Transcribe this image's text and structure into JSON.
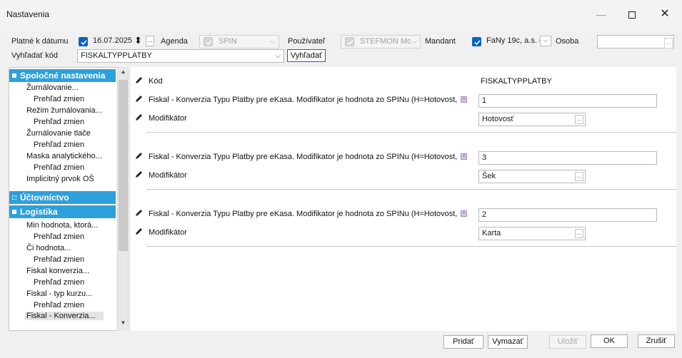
{
  "window": {
    "title": "Nastavenia",
    "minimize_glyph": "—",
    "close_glyph": "✕"
  },
  "filters": {
    "valid_date_label": "Platné k dátumu",
    "valid_date_value": "16.07.2025",
    "agenda_label": "Agenda",
    "agenda_value": "SPIN",
    "user_label": "Používateľ",
    "user_value": "STEFMON Mc",
    "mandant_label": "Mandant",
    "mandant_value": "FaNy 19c, a.s. (",
    "person_label": "Osoba",
    "person_value": "",
    "search_code_label": "Vyhľadať kód",
    "search_code_value": "FISKALTYPPLATBY",
    "search_button": "Vyhľadať",
    "ellipsis": "...",
    "dropdown_glyph": "⌵",
    "spin_glyph": "⬍"
  },
  "tree": {
    "sections": [
      {
        "label": "Spoločné nastavenia"
      },
      {
        "label": "Účtovníctvo"
      },
      {
        "label": "Logistika"
      }
    ],
    "common_items": [
      {
        "label": "Žurnálovanie...",
        "level": 1
      },
      {
        "label": "Prehľad zmien",
        "level": 2
      },
      {
        "label": "Režim žurnálovania...",
        "level": 1
      },
      {
        "label": "Prehľad zmien",
        "level": 2
      },
      {
        "label": "Žurnálovanie tlače",
        "level": 1
      },
      {
        "label": "Prehľad zmien",
        "level": 2
      },
      {
        "label": "Maska analytického...",
        "level": 1
      },
      {
        "label": "Prehľad zmien",
        "level": 2
      },
      {
        "label": "Implicitný prvok OŠ",
        "level": 1
      }
    ],
    "logistics_items": [
      {
        "label": "Min hodnota, ktorá...",
        "level": 1
      },
      {
        "label": "Prehľad zmien",
        "level": 2
      },
      {
        "label": "Či hodnota...",
        "level": 1
      },
      {
        "label": "Prehľad zmien",
        "level": 2
      },
      {
        "label": "Fiskal konverzia...",
        "level": 1
      },
      {
        "label": "Prehľad zmien",
        "level": 2
      },
      {
        "label": "Fiskal - typ kurzu...",
        "level": 1
      },
      {
        "label": "Prehľad zmien",
        "level": 2
      },
      {
        "label": "Fiskal - Konverzia...",
        "level": 1,
        "selected": true
      }
    ],
    "scroll_up": "▲",
    "scroll_down": "▼"
  },
  "detail": {
    "code_label": "Kód",
    "code_value": "FISKALTYPPLATBY",
    "groups": [
      {
        "param_label": "Fiskal - Konverzia Typu Platby pre eKasa. Modifikator je hodnota zo SPINu (H=Hotovost,",
        "param_value": "1",
        "modifier_label": "Modifikátor",
        "modifier_value": "Hotovosť"
      },
      {
        "param_label": "Fiskal - Konverzia Typu Platby pre eKasa. Modifikator je hodnota zo SPINu (H=Hotovost,",
        "param_value": "3",
        "modifier_label": "Modifikátor",
        "modifier_value": "Šek"
      },
      {
        "param_label": "Fiskal - Konverzia Typu Platby pre eKasa. Modifikator je hodnota zo SPINu (H=Hotovost,",
        "param_value": "2",
        "modifier_label": "Modifikátor",
        "modifier_value": "Karta"
      }
    ],
    "expand_badge": "»"
  },
  "footer": {
    "add": "Pridať",
    "delete": "Vymazať",
    "save": "Uložiť",
    "ok": "OK",
    "cancel": "Zrušiť"
  },
  "colors": {
    "accent": "#0a64c2",
    "section_header": "#2ea0dc"
  }
}
